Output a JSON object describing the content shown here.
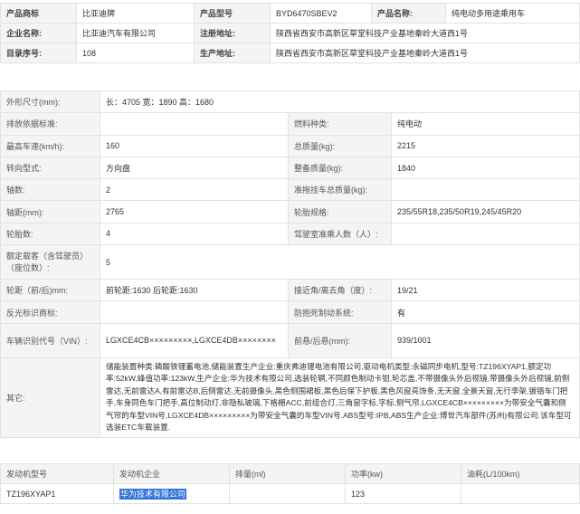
{
  "basic": {
    "rows": [
      [
        {
          "label": "产品商标",
          "value": "比亚迪牌"
        },
        {
          "label": "产品型号",
          "value": "BYD6470SBEV2"
        },
        {
          "label": "产品名称:",
          "value": "纯电动多用途乘用车"
        }
      ],
      [
        {
          "label": "企业名称:",
          "value": "比亚迪汽车有限公司"
        },
        {
          "label": "注册地址:",
          "value": "陕西省西安市高新区草堂科技产业基地秦岭大道西1号"
        }
      ],
      [
        {
          "label": "目录序号:",
          "value": "108"
        },
        {
          "label": "生产地址:",
          "value": "陕西省西安市高新区草堂科技产业基地秦岭大道西1号"
        }
      ]
    ]
  },
  "specs": {
    "dimensions": {
      "label": "外形尺寸(mm):",
      "value": "长：4705 宽：1890 高：1680"
    },
    "rows": [
      [
        {
          "label": "排放依据标准:",
          "value": ""
        },
        {
          "label": "燃料种类:",
          "value": "纯电动"
        }
      ],
      [
        {
          "label": "最高车速(km/h):",
          "value": "160"
        },
        {
          "label": "总质量(kg):",
          "value": "2215"
        }
      ],
      [
        {
          "label": "转向型式:",
          "value": "方向盘"
        },
        {
          "label": "整备质量(kg):",
          "value": "1840"
        }
      ],
      [
        {
          "label": "轴数:",
          "value": "2"
        },
        {
          "label": "准拖挂车总质量(kg):",
          "value": ""
        }
      ],
      [
        {
          "label": "轴距(mm):",
          "value": "2765"
        },
        {
          "label": "轮胎规格:",
          "value": "235/55R18,235/50R19,245/45R20"
        }
      ],
      [
        {
          "label": "轮胎数:",
          "value": "4"
        },
        {
          "label": "驾驶室准乘人数（人）:",
          "value": ""
        }
      ]
    ],
    "seats": {
      "label": "额定载客（含驾驶员）（座位数）:",
      "value": "5"
    },
    "rows2": [
      [
        {
          "label": "轮距（前/后)mm:",
          "value": "前轮距:1630 后轮距:1630"
        },
        {
          "label": "接近角/离去角（度）:",
          "value": "19/21"
        }
      ],
      [
        {
          "label": "反光标识商标:",
          "value": ""
        },
        {
          "label": "防抱死制动系统:",
          "value": "有"
        }
      ]
    ],
    "vin": {
      "label": "车辆识别代号（VIN）:",
      "value": "LGXCE4CB×××××××××,LGXCE4DB××××××××",
      "label2": "前悬/后悬(mm):",
      "value2": "939/1001"
    },
    "other": {
      "label": "其它:",
      "value": "储能装置种类:磷酸铁锂蓄电池,储能装置生产企业:重庆弗迪锂电池有限公司,驱动电机类型:永磁同步电机,型号:TZ196XYAP1,额定功率:52kW,峰值功率:123kW,生产企业:华为技术有限公司,选装轮辋,不同颜色制动卡钳,轮芯盖,不带摄像头外后视镜,带摄像头外后视镜,前侧雷达,无前雷达A,有前雷达B,后侧雷达,无前摄像头,黑色侧围裙板,黑色后保下护板,黑色风窗亮饰条,无天窗,全景天窗,无行李架,镀铬车门把手,车身同色车门把手,高位制动灯,非隐私玻璃,下格栅ACC,前组合灯,三角窗字标,字标,侧气帘,LGXCE4CB×××××××××为带安全气囊和侧气帘的车型VIN号,LGXCE4DB×××××××××为带安全气囊的车型VIN号.ABS型号:IPB,ABS生产企业:博世汽车部件(苏州)有限公司.该车型可选装ETC车载装置."
    }
  },
  "engine": {
    "headers": [
      "发动机型号",
      "发动机企业",
      "排量(ml)",
      "功率(kw)",
      "油耗(L/100km)"
    ],
    "row": {
      "model": "TZ196XYAP1",
      "maker": "华为技术有限公司",
      "displacement": "",
      "power": "123",
      "fuel": ""
    }
  }
}
